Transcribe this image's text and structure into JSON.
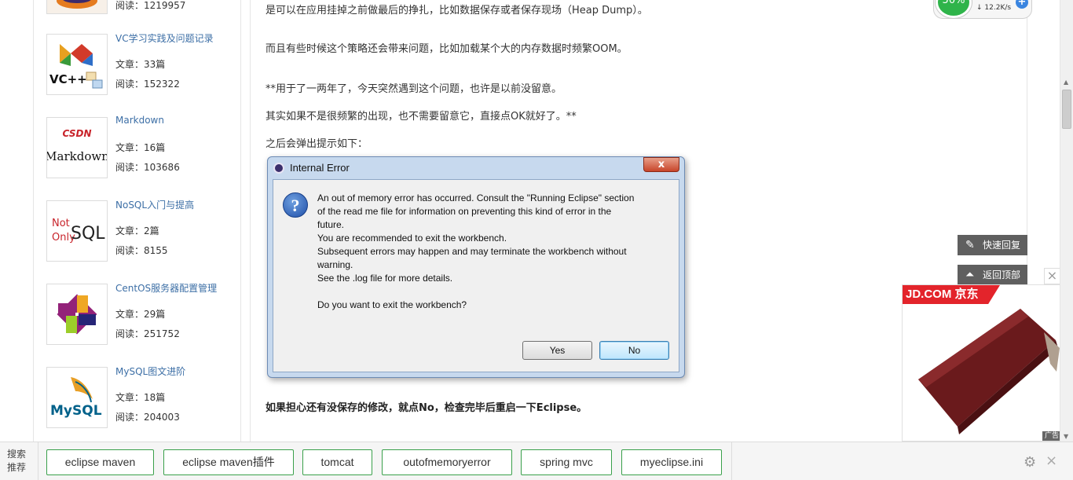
{
  "sidebar": {
    "columns": [
      {
        "thumb": "vc",
        "title": "VC学习实践及问题记录",
        "articles_label": "文章：",
        "articles": "33篇",
        "reads_label": "阅读：",
        "reads": "152322"
      },
      {
        "thumb": "markdown",
        "title": "Markdown",
        "articles_label": "文章：",
        "articles": "16篇",
        "reads_label": "阅读：",
        "reads": "103686"
      },
      {
        "thumb": "nosql",
        "title": "NoSQL入门与提高",
        "articles_label": "文章：",
        "articles": "2篇",
        "reads_label": "阅读：",
        "reads": "8155"
      },
      {
        "thumb": "centos",
        "title": "CentOS服务器配置管理",
        "articles_label": "文章：",
        "articles": "29篇",
        "reads_label": "阅读：",
        "reads": "251752"
      },
      {
        "thumb": "mysql",
        "title": "MySQL图文进阶",
        "articles_label": "文章：",
        "articles": "18篇",
        "reads_label": "阅读：",
        "reads": "204003"
      }
    ],
    "top_partial_reads": "阅读：1219957",
    "thumb_texts": {
      "vc": "VC++",
      "csdn": "CSDN",
      "markdown": "Markdown",
      "nosql_not": "Not",
      "nosql_only": "Only",
      "nosql_sql": "SQL",
      "mysql": "MySQL"
    }
  },
  "article": {
    "p1": "是可以在应用挂掉之前做最后的挣扎，比如数据保存或者保存现场（Heap Dump）。",
    "p2": "而且有些时候这个策略还会带来问题，比如加载某个大的内存数据时频繁OOM。",
    "p3": "**用于了一两年了，今天突然遇到这个问题，也许是以前没留意。",
    "p4": "其实如果不是很频繁的出现，也不需要留意它，直接点OK就好了。**",
    "p5": "之后会弹出提示如下：",
    "p6": "如果担心还有没保存的修改，就点No，检查完毕后重启一下Eclipse。"
  },
  "dialog": {
    "title": "Internal Error",
    "close_glyph": "x",
    "question_glyph": "?",
    "lines": [
      "An out of memory error has occurred. Consult the \"Running Eclipse\" section",
      "of the read me file for information on preventing this kind of error in the",
      "future.",
      "You are recommended to exit the workbench.",
      "Subsequent errors may happen and may terminate the workbench without",
      "warning.",
      "See the .log file for more details.",
      "",
      "Do you want to exit the workbench?"
    ],
    "yes_label": "Yes",
    "no_label": "No"
  },
  "floating": {
    "quick_reply": "快速回复",
    "back_to_top": "返回顶部"
  },
  "ad": {
    "brand": "JD.COM 京东",
    "tag": "广告",
    "close_glyph": "×"
  },
  "widget": {
    "percent": "50%",
    "speed": "12.2K/s",
    "plus": "+"
  },
  "bottom": {
    "label_line1": "搜索",
    "label_line2": "推荐",
    "tags": [
      "eclipse maven",
      "eclipse maven插件",
      "tomcat",
      "outofmemoryerror",
      "spring mvc",
      "myeclipse.ini"
    ],
    "close_glyph": "×"
  },
  "colors": {
    "accent_green": "#3aa04b",
    "link_blue": "#3d6fa6",
    "jd_red": "#e3242b",
    "dialog_frame": "#c7d9ee"
  }
}
